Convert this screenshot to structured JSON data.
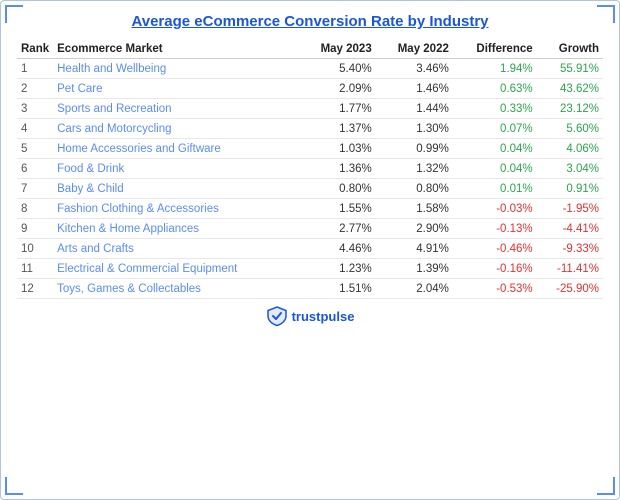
{
  "title": "Average eCommerce Conversion Rate by Industry",
  "columns": [
    "Rank",
    "Ecommerce Market",
    "May 2023",
    "May 2022",
    "Difference",
    "Growth"
  ],
  "rows": [
    {
      "rank": "1",
      "market": "Health and Wellbeing",
      "may2023": "5.40%",
      "may2022": "3.46%",
      "difference": "1.94%",
      "growth": "55.91%",
      "diff_sign": "pos",
      "growth_sign": "pos"
    },
    {
      "rank": "2",
      "market": "Pet Care",
      "may2023": "2.09%",
      "may2022": "1.46%",
      "difference": "0.63%",
      "growth": "43.62%",
      "diff_sign": "pos",
      "growth_sign": "pos"
    },
    {
      "rank": "3",
      "market": "Sports and Recreation",
      "may2023": "1.77%",
      "may2022": "1.44%",
      "difference": "0.33%",
      "growth": "23.12%",
      "diff_sign": "pos",
      "growth_sign": "pos"
    },
    {
      "rank": "4",
      "market": "Cars and Motorcycling",
      "may2023": "1.37%",
      "may2022": "1.30%",
      "difference": "0.07%",
      "growth": "5.60%",
      "diff_sign": "pos",
      "growth_sign": "pos"
    },
    {
      "rank": "5",
      "market": "Home Accessories and Giftware",
      "may2023": "1.03%",
      "may2022": "0.99%",
      "difference": "0.04%",
      "growth": "4.06%",
      "diff_sign": "pos",
      "growth_sign": "pos"
    },
    {
      "rank": "6",
      "market": "Food & Drink",
      "may2023": "1.36%",
      "may2022": "1.32%",
      "difference": "0.04%",
      "growth": "3.04%",
      "diff_sign": "pos",
      "growth_sign": "pos"
    },
    {
      "rank": "7",
      "market": "Baby & Child",
      "may2023": "0.80%",
      "may2022": "0.80%",
      "difference": "0.01%",
      "growth": "0.91%",
      "diff_sign": "pos",
      "growth_sign": "pos"
    },
    {
      "rank": "8",
      "market": "Fashion Clothing & Accessories",
      "may2023": "1.55%",
      "may2022": "1.58%",
      "difference": "-0.03%",
      "growth": "-1.95%",
      "diff_sign": "neg",
      "growth_sign": "neg"
    },
    {
      "rank": "9",
      "market": "Kitchen & Home Appliances",
      "may2023": "2.77%",
      "may2022": "2.90%",
      "difference": "-0.13%",
      "growth": "-4.41%",
      "diff_sign": "neg",
      "growth_sign": "neg"
    },
    {
      "rank": "10",
      "market": "Arts and Crafts",
      "may2023": "4.46%",
      "may2022": "4.91%",
      "difference": "-0.46%",
      "growth": "-9.33%",
      "diff_sign": "neg",
      "growth_sign": "neg"
    },
    {
      "rank": "11",
      "market": "Electrical & Commercial Equipment",
      "may2023": "1.23%",
      "may2022": "1.39%",
      "difference": "-0.16%",
      "growth": "-11.41%",
      "diff_sign": "neg",
      "growth_sign": "neg"
    },
    {
      "rank": "12",
      "market": "Toys, Games & Collectables",
      "may2023": "1.51%",
      "may2022": "2.04%",
      "difference": "-0.53%",
      "growth": "-25.90%",
      "diff_sign": "neg",
      "growth_sign": "neg"
    }
  ],
  "footer": {
    "brand": "trustpulse"
  }
}
